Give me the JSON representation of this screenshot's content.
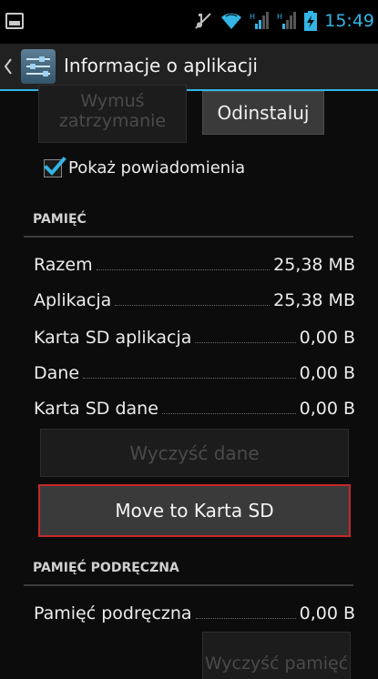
{
  "status_bar": {
    "time": "15:49",
    "icons": [
      "screenshot-thumbnail-icon",
      "mute-icon",
      "wifi-icon",
      "signal-icon",
      "signal-icon",
      "battery-charging-icon"
    ],
    "accent_color": "#33b5e5"
  },
  "action_bar": {
    "title": "Informacje o aplikacji",
    "icon": "settings-sliders-icon"
  },
  "buttons": {
    "force_stop": "Wymuś zatrzymanie",
    "uninstall": "Odinstaluj",
    "clear_data": "Wyczyść dane",
    "move_to_sd": "Move to Karta SD",
    "clear_cache": "Wyczyść pamięć"
  },
  "notifications": {
    "label": "Pokaż powiadomienia",
    "checked": true
  },
  "storage": {
    "header": "PAMIĘĆ",
    "rows": [
      {
        "label": "Razem",
        "value": "25,38 MB"
      },
      {
        "label": "Aplikacja",
        "value": "25,38 MB"
      },
      {
        "label": "Karta SD aplikacja",
        "value": "0,00 B"
      },
      {
        "label": "Dane",
        "value": "0,00 B"
      },
      {
        "label": "Karta SD dane",
        "value": "0,00 B"
      }
    ]
  },
  "cache": {
    "header": "PAMIĘĆ PODRĘCZNA",
    "rows": [
      {
        "label": "Pamięć podręczna",
        "value": "0,00 B"
      }
    ]
  },
  "colors": {
    "background": "#0c0c0c",
    "action_bar": "#212121",
    "focus_border": "#c62828",
    "disabled_text": "#4a4a4a"
  }
}
